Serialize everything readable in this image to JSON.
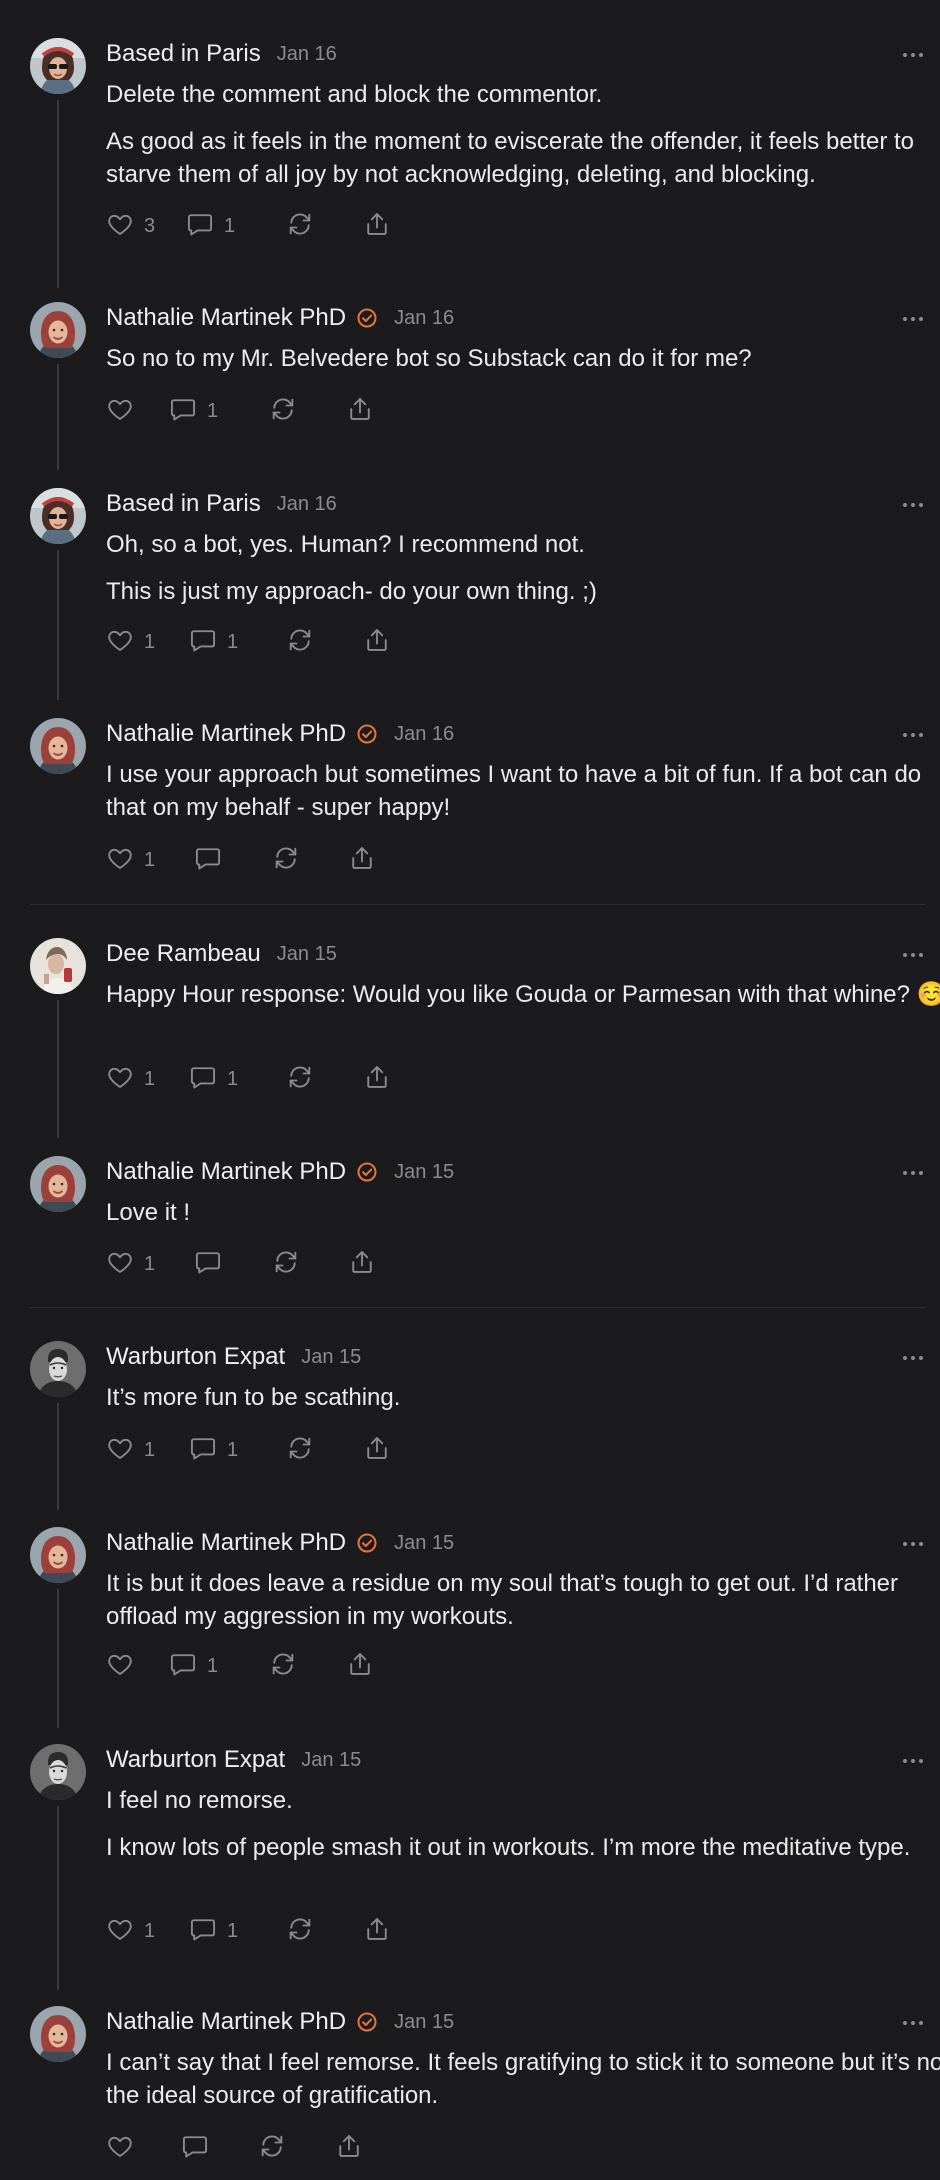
{
  "accent_color": "#e8743b",
  "comments": [
    {
      "author": "Based in Paris",
      "date": "Jan 16",
      "verified": false,
      "avatar": "sunglasses-woman",
      "paragraphs": [
        "Delete the comment and block the commentor.",
        "As good as it feels in the moment to eviscerate the offender, it feels better to starve them of all joy by not acknowledging, deleting, and blocking."
      ],
      "likes": "3",
      "replies": "1"
    },
    {
      "author": "Nathalie Martinek PhD",
      "date": "Jan 16",
      "verified": true,
      "avatar": "red-hair-woman",
      "paragraphs": [
        "So no to my Mr. Belvedere bot so Substack can do it for me?"
      ],
      "likes": "",
      "replies": "1"
    },
    {
      "author": "Based in Paris",
      "date": "Jan 16",
      "verified": false,
      "avatar": "sunglasses-woman",
      "paragraphs": [
        "Oh, so a bot, yes. Human? I recommend not.",
        "This is just my approach- do your own thing. ;)"
      ],
      "likes": "1",
      "replies": "1"
    },
    {
      "author": "Nathalie Martinek PhD",
      "date": "Jan 16",
      "verified": true,
      "avatar": "red-hair-woman",
      "paragraphs": [
        "I use your approach but sometimes I want to have a bit of fun. If a bot can do that on my behalf - super happy!"
      ],
      "likes": "1",
      "replies": ""
    },
    {
      "author": "Dee Rambeau",
      "date": "Jan 15",
      "verified": false,
      "avatar": "light-portrait",
      "paragraphs": [
        "Happy Hour response: Would you like Gouda or Parmesan with that whine? ☺️"
      ],
      "likes": "1",
      "replies": "1"
    },
    {
      "author": "Nathalie Martinek PhD",
      "date": "Jan 15",
      "verified": true,
      "avatar": "red-hair-woman",
      "paragraphs": [
        "Love it !"
      ],
      "likes": "1",
      "replies": ""
    },
    {
      "author": "Warburton Expat",
      "date": "Jan 15",
      "verified": false,
      "avatar": "bw-man",
      "paragraphs": [
        "It’s more fun to be scathing."
      ],
      "likes": "1",
      "replies": "1"
    },
    {
      "author": "Nathalie Martinek PhD",
      "date": "Jan 15",
      "verified": true,
      "avatar": "red-hair-woman",
      "paragraphs": [
        "It is but it does leave a residue on my soul that’s tough to get out. I’d rather offload my aggression in my workouts."
      ],
      "likes": "",
      "replies": "1"
    },
    {
      "author": "Warburton Expat",
      "date": "Jan 15",
      "verified": false,
      "avatar": "bw-man",
      "paragraphs": [
        "I feel no remorse.",
        "I know lots of people smash it out in workouts. I’m more the meditative type."
      ],
      "likes": "1",
      "replies": "1"
    },
    {
      "author": "Nathalie Martinek PhD",
      "date": "Jan 15",
      "verified": true,
      "avatar": "red-hair-woman",
      "paragraphs": [
        "I can’t say that I feel remorse. It feels gratifying to stick it to someone but it’s not the ideal source of gratification."
      ],
      "likes": "",
      "replies": ""
    }
  ]
}
